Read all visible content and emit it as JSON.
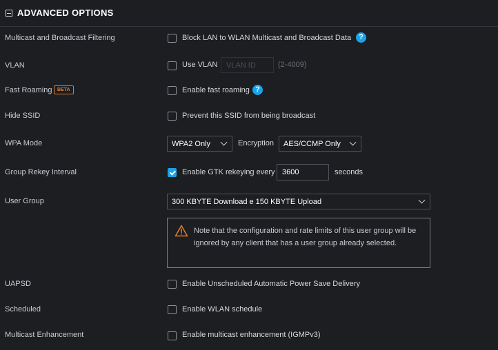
{
  "header": {
    "title": "ADVANCED OPTIONS"
  },
  "rows": {
    "multicast_filtering": {
      "label": "Multicast and Broadcast Filtering",
      "option": "Block LAN to WLAN Multicast and Broadcast Data",
      "checked": false
    },
    "vlan": {
      "label": "VLAN",
      "option": "Use VLAN",
      "checked": false,
      "input_placeholder": "VLAN ID",
      "range_hint": "(2-4009)"
    },
    "fast_roaming": {
      "label": "Fast Roaming",
      "badge": "BETA",
      "option": "Enable fast roaming",
      "checked": false
    },
    "hide_ssid": {
      "label": "Hide SSID",
      "option": "Prevent this SSID from being broadcast",
      "checked": false
    },
    "wpa_mode": {
      "label": "WPA Mode",
      "mode_value": "WPA2 Only",
      "encryption_label": "Encryption",
      "encryption_value": "AES/CCMP Only"
    },
    "group_rekey": {
      "label": "Group Rekey Interval",
      "option": "Enable GTK rekeying every",
      "checked": true,
      "interval_value": "3600",
      "unit": "seconds"
    },
    "user_group": {
      "label": "User Group",
      "selected": "300 KBYTE Download e 150 KBYTE Upload",
      "warning": "Note that the configuration and rate limits of this user group will be ignored by any client that has a user group already selected."
    },
    "uapsd": {
      "label": "UAPSD",
      "option": "Enable Unscheduled Automatic Power Save Delivery",
      "checked": false
    },
    "scheduled": {
      "label": "Scheduled",
      "option": "Enable WLAN schedule",
      "checked": false
    },
    "multicast_enhancement": {
      "label": "Multicast Enhancement",
      "option": "Enable multicast enhancement (IGMPv3)",
      "checked": false
    }
  },
  "icons": {
    "help": "help-circle-icon",
    "warning": "warning-triangle-icon",
    "collapse": "collapse-minus-icon",
    "dropdown": "chevron-down-icon"
  },
  "colors": {
    "accent": "#1aa3e8",
    "beta": "#e07b2a",
    "warning": "#e07b2a",
    "background": "#1c1e22"
  }
}
